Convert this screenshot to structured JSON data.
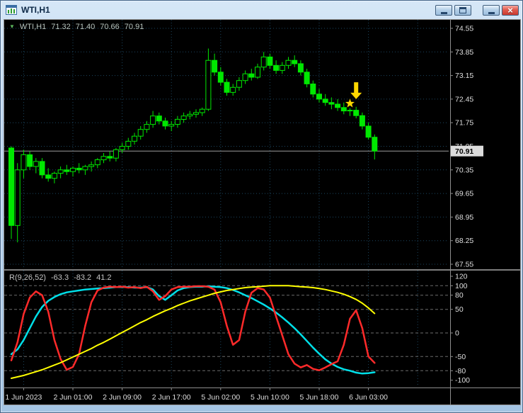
{
  "window": {
    "title": "WTI,H1",
    "close_glyph": "×"
  },
  "main_chart_header": {
    "dropdown_glyph": "▼",
    "symbol": "WTI,H1",
    "open": "71.32",
    "high": "71.40",
    "low": "70.66",
    "close": "70.91"
  },
  "indicator_header": {
    "name": "R(9,26,52)",
    "values": [
      "-63.3",
      "-83.2",
      "41.2"
    ]
  },
  "colors": {
    "background": "#000000",
    "grid": "#1c4660",
    "candle": "#00E800",
    "axis_text": "#DFDFDF",
    "price_tag_bg": "#DCDCDC",
    "indicator_line_1": "#FF2A2A",
    "indicator_line_2": "#00DFE8",
    "indicator_line_3": "#FFFF00",
    "signal": "#FFD700"
  },
  "chart_data": [
    {
      "type": "candlestick",
      "title": "WTI,H1",
      "ylim": [
        67.55,
        74.55
      ],
      "y_ticks": [
        74.55,
        73.85,
        73.15,
        72.45,
        71.75,
        71.05,
        70.35,
        69.65,
        68.95,
        68.25,
        67.55
      ],
      "current_price": 70.91,
      "current_price_label": "70.91",
      "x_labels": [
        "1 Jun 2023",
        "2 Jun 01:00",
        "2 Jun 09:00",
        "2 Jun 17:00",
        "5 Jun 02:00",
        "5 Jun 10:00",
        "5 Jun 18:00",
        "6 Jun 03:00"
      ],
      "x_label_bars": [
        2,
        10,
        18,
        26,
        34,
        42,
        50,
        58
      ],
      "candles_ohlc": [
        [
          71.0,
          71.05,
          68.3,
          68.7
        ],
        [
          68.7,
          70.55,
          68.2,
          70.35
        ],
        [
          70.35,
          70.95,
          70.1,
          70.8
        ],
        [
          70.8,
          70.9,
          70.35,
          70.45
        ],
        [
          70.45,
          70.7,
          70.25,
          70.6
        ],
        [
          70.6,
          70.7,
          70.1,
          70.2
        ],
        [
          70.2,
          70.4,
          70.0,
          70.1
        ],
        [
          70.1,
          70.3,
          69.95,
          70.25
        ],
        [
          70.25,
          70.45,
          70.1,
          70.35
        ],
        [
          70.35,
          70.5,
          70.2,
          70.3
        ],
        [
          70.3,
          70.45,
          70.15,
          70.4
        ],
        [
          70.4,
          70.55,
          70.25,
          70.35
        ],
        [
          70.35,
          70.5,
          70.2,
          70.45
        ],
        [
          70.45,
          70.6,
          70.3,
          70.5
        ],
        [
          70.5,
          70.7,
          70.4,
          70.65
        ],
        [
          70.65,
          70.85,
          70.55,
          70.75
        ],
        [
          70.75,
          70.9,
          70.6,
          70.7
        ],
        [
          70.7,
          71.0,
          70.6,
          70.95
        ],
        [
          70.95,
          71.15,
          70.85,
          71.05
        ],
        [
          71.05,
          71.3,
          70.95,
          71.2
        ],
        [
          71.2,
          71.45,
          71.1,
          71.35
        ],
        [
          71.35,
          71.65,
          71.25,
          71.55
        ],
        [
          71.55,
          71.8,
          71.45,
          71.7
        ],
        [
          71.7,
          72.1,
          71.6,
          71.95
        ],
        [
          71.95,
          72.05,
          71.7,
          71.8
        ],
        [
          71.8,
          71.9,
          71.55,
          71.65
        ],
        [
          71.65,
          71.8,
          71.5,
          71.7
        ],
        [
          71.7,
          71.95,
          71.6,
          71.85
        ],
        [
          71.85,
          72.05,
          71.75,
          71.95
        ],
        [
          71.95,
          72.1,
          71.85,
          72.0
        ],
        [
          72.0,
          72.15,
          71.9,
          72.05
        ],
        [
          72.05,
          72.2,
          71.95,
          72.15
        ],
        [
          72.15,
          73.95,
          72.1,
          73.6
        ],
        [
          73.6,
          73.8,
          73.15,
          73.25
        ],
        [
          73.25,
          73.4,
          72.85,
          72.95
        ],
        [
          72.95,
          73.05,
          72.55,
          72.65
        ],
        [
          72.65,
          72.9,
          72.55,
          72.8
        ],
        [
          72.8,
          73.1,
          72.7,
          73.0
        ],
        [
          73.0,
          73.3,
          72.9,
          73.2
        ],
        [
          73.2,
          73.35,
          73.0,
          73.1
        ],
        [
          73.1,
          73.5,
          73.05,
          73.4
        ],
        [
          73.4,
          73.85,
          73.3,
          73.7
        ],
        [
          73.7,
          73.8,
          73.35,
          73.45
        ],
        [
          73.45,
          73.6,
          73.2,
          73.3
        ],
        [
          73.3,
          73.55,
          73.2,
          73.45
        ],
        [
          73.45,
          73.7,
          73.35,
          73.6
        ],
        [
          73.6,
          73.75,
          73.4,
          73.5
        ],
        [
          73.5,
          73.6,
          73.15,
          73.25
        ],
        [
          73.25,
          73.35,
          72.8,
          72.9
        ],
        [
          72.9,
          73.0,
          72.5,
          72.6
        ],
        [
          72.6,
          72.75,
          72.35,
          72.45
        ],
        [
          72.45,
          72.6,
          72.25,
          72.35
        ],
        [
          72.35,
          72.5,
          72.15,
          72.3
        ],
        [
          72.3,
          72.45,
          72.1,
          72.2
        ],
        [
          72.2,
          72.35,
          72.0,
          72.1
        ],
        [
          72.1,
          72.18,
          71.95,
          72.12
        ],
        [
          72.12,
          72.22,
          71.88,
          71.96
        ],
        [
          71.96,
          72.05,
          71.55,
          71.65
        ],
        [
          71.65,
          71.75,
          71.25,
          71.32
        ],
        [
          71.32,
          71.4,
          70.66,
          70.91
        ]
      ],
      "markers": [
        {
          "type": "arrow-down",
          "bar": 56,
          "price": 72.95,
          "price_tip": 72.45,
          "color": "#FFD700"
        },
        {
          "type": "star",
          "bar": 55,
          "price": 72.32,
          "color": "#FFD700"
        }
      ]
    },
    {
      "type": "line",
      "title": "R(9,26,52)",
      "ylim": [
        -105,
        123
      ],
      "y_ticks": [
        120,
        100,
        80,
        50,
        0,
        -50,
        -80,
        -100
      ],
      "levels": [
        100,
        80,
        50,
        0,
        -50,
        -80
      ],
      "series": [
        {
          "name": "R line 1",
          "color": "#FF2A2A",
          "width": 2.5,
          "values": [
            -58,
            -20,
            40,
            75,
            88,
            80,
            45,
            -15,
            -55,
            -78,
            -72,
            -45,
            15,
            65,
            90,
            96,
            98,
            97,
            98,
            96,
            97,
            95,
            98,
            88,
            70,
            78,
            92,
            97,
            98,
            98,
            99,
            99,
            98,
            92,
            65,
            15,
            -25,
            -15,
            45,
            85,
            95,
            92,
            75,
            35,
            -5,
            -45,
            -65,
            -73,
            -68,
            -76,
            -79,
            -73,
            -66,
            -60,
            -25,
            30,
            48,
            10,
            -50,
            -63.3
          ]
        },
        {
          "name": "R line 2",
          "color": "#00DFE8",
          "width": 2.5,
          "values": [
            -45,
            -35,
            -15,
            10,
            35,
            55,
            68,
            76,
            82,
            86,
            88,
            90,
            92,
            93,
            94,
            95,
            96,
            97,
            97,
            97,
            96,
            96,
            97,
            92,
            78,
            70,
            80,
            90,
            95,
            97,
            98,
            98,
            99,
            98,
            97,
            95,
            91,
            86,
            80,
            74,
            67,
            60,
            52,
            43,
            33,
            22,
            10,
            -3,
            -17,
            -31,
            -44,
            -56,
            -65,
            -72,
            -77,
            -80,
            -84,
            -86,
            -85,
            -83.2
          ]
        },
        {
          "name": "R line 3",
          "color": "#FFFF00",
          "width": 2,
          "values": [
            -96,
            -93,
            -90,
            -86,
            -82,
            -78,
            -73,
            -68,
            -63,
            -57,
            -51,
            -45,
            -39,
            -33,
            -26,
            -20,
            -13,
            -6,
            1,
            8,
            15,
            22,
            28,
            35,
            41,
            47,
            52,
            58,
            63,
            68,
            72,
            76,
            80,
            84,
            87,
            90,
            92,
            94,
            96,
            97,
            98,
            99,
            100,
            100,
            100,
            100,
            99,
            98,
            97,
            96,
            94,
            92,
            89,
            86,
            82,
            77,
            71,
            63,
            53,
            41.2
          ]
        }
      ]
    }
  ]
}
